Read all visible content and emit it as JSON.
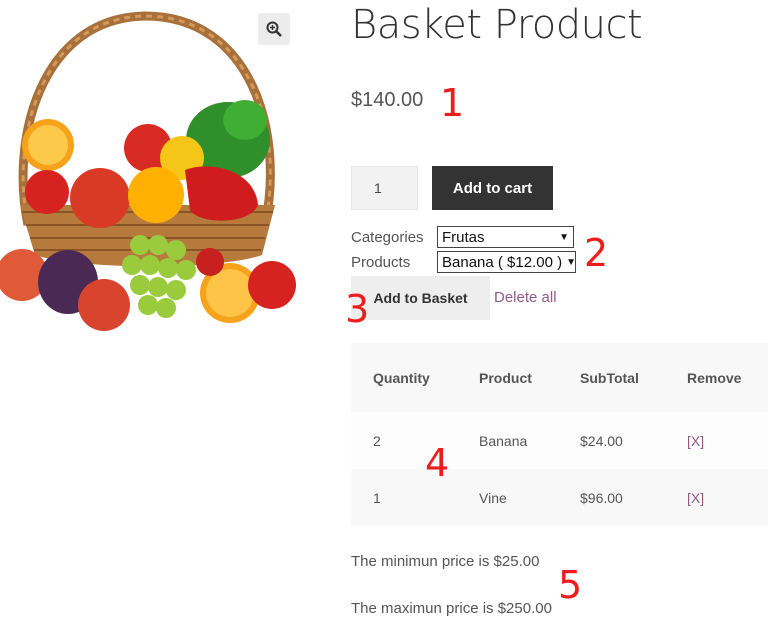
{
  "product": {
    "title": "Basket Product",
    "price": "$140.00",
    "quantity": "1",
    "add_to_cart_label": "Add to cart",
    "image_alt": "fruit-basket"
  },
  "filters": {
    "categories_label": "Categories",
    "categories_value": "Frutas",
    "products_label": "Products",
    "products_value": "Banana ( $12.00 )"
  },
  "basket": {
    "add_label": "Add to Basket",
    "delete_all_label": "Delete all",
    "headers": [
      "Quantity",
      "Product",
      "SubTotal",
      "Remove"
    ],
    "rows": [
      {
        "quantity": "2",
        "product": "Banana",
        "subtotal": "$24.00",
        "remove": "[X]"
      },
      {
        "quantity": "1",
        "product": "Vine",
        "subtotal": "$96.00",
        "remove": "[X]"
      }
    ]
  },
  "limits": {
    "min_text": "The minimun price is $25.00",
    "max_text": "The maximun price is $250.00"
  },
  "annotations": [
    "1",
    "2",
    "3",
    "4",
    "5"
  ],
  "colors": {
    "accent": "#96588a",
    "button_dark": "#333333",
    "annotation": "#ee1d1d"
  }
}
